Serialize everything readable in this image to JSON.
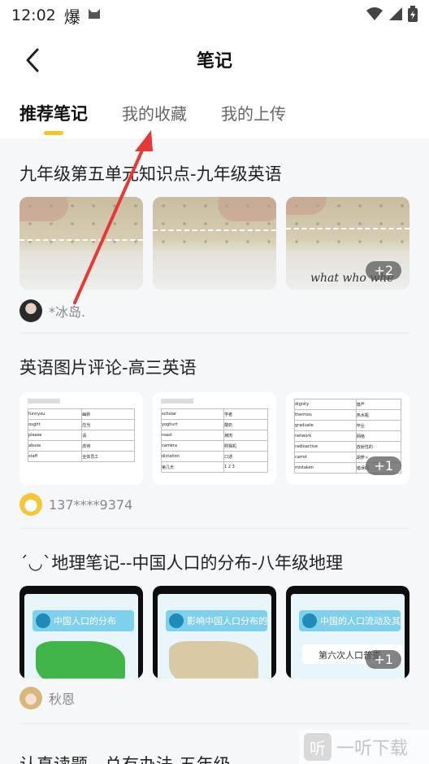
{
  "status": {
    "time": "12:02"
  },
  "nav": {
    "title": "笔记"
  },
  "tabs": [
    {
      "label": "推荐笔记",
      "active": true
    },
    {
      "label": "我的收藏",
      "active": false
    },
    {
      "label": "我的上传",
      "active": false
    }
  ],
  "notes": [
    {
      "title": "九年级第五单元知识点-九年级英语",
      "author": "*冰岛.",
      "more": "+2"
    },
    {
      "title": "英语图片评论-高三英语",
      "author": "137****9374",
      "more": "+1"
    },
    {
      "title": "´◡`地理笔记--中国人口的分布-八年级地理",
      "author": "秋恩",
      "more": "+1"
    },
    {
      "title": "认真读题，总有办法-五年级"
    }
  ],
  "thumb_text": {
    "geo_1": "中国人口的分布",
    "geo_2": "影响中国人口分布的",
    "geo_3": "中国的人口流动及其",
    "geo_3_sub": "第六次人口普查",
    "paper_3_hand": "what who whe",
    "table_1": [
      "funnyou",
      "ought",
      "please",
      "abuse",
      "staff"
    ],
    "table_1_r": [
      "幽默",
      "应当",
      "请",
      "虐待",
      "全体员工"
    ],
    "table_2": [
      "scholar",
      "yoghurt",
      "roast",
      "camera",
      "dictation",
      "第几天"
    ],
    "table_2_r": [
      "学者",
      "酸奶",
      "烤肉",
      "照相机",
      "口述",
      "1 2 3"
    ],
    "table_3": [
      "dignity",
      "thermos",
      "graduate",
      "network",
      "radioactive",
      "carrot",
      "mistaken"
    ],
    "table_3_r": [
      "尊严",
      "热水瓶",
      "毕业",
      "网络",
      "放射性的",
      "胡萝卜",
      "错误的"
    ]
  },
  "watermark": {
    "text": "一听下载",
    "badge": "听"
  },
  "colors": {
    "accent": "#f8c325",
    "arrow": "#e53935",
    "feed_bg": "#f6f7f9"
  }
}
